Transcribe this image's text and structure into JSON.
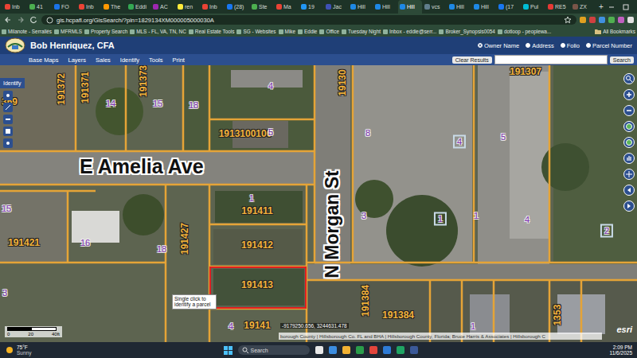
{
  "browser": {
    "tabs": [
      {
        "label": "Inb",
        "selected": false
      },
      {
        "label": "41",
        "selected": false
      },
      {
        "label": "FO",
        "selected": false
      },
      {
        "label": "Inb",
        "selected": false
      },
      {
        "label": "The",
        "selected": false
      },
      {
        "label": "Eddi",
        "selected": false
      },
      {
        "label": "AC",
        "selected": false
      },
      {
        "label": "ren",
        "selected": false
      },
      {
        "label": "Inb",
        "selected": false
      },
      {
        "label": "(28)",
        "selected": false
      },
      {
        "label": "Ste",
        "selected": false
      },
      {
        "label": "Ma",
        "selected": false
      },
      {
        "label": "19",
        "selected": false
      },
      {
        "label": "Jac",
        "selected": false
      },
      {
        "label": "Hill",
        "selected": false
      },
      {
        "label": "Hill",
        "selected": false
      },
      {
        "label": "Hill",
        "selected": true
      },
      {
        "label": "vcs",
        "selected": false
      },
      {
        "label": "Hill",
        "selected": false
      },
      {
        "label": "Hill",
        "selected": false
      },
      {
        "label": "(17",
        "selected": false
      },
      {
        "label": "Pul",
        "selected": false
      },
      {
        "label": "RE5",
        "selected": false
      },
      {
        "label": "ZX",
        "selected": false
      }
    ],
    "new_tab": "+",
    "url": "gis.hcpafl.org/GisSearch/?pin=1829134XM000005000030A",
    "bookmarks": [
      "Milanote - Serrallés",
      "MFRMLS",
      "Property Search",
      "MLS - FL, VA, TN, NC",
      "Real Estate Tools",
      "SG - Websites",
      "Mike",
      "Eddie",
      "Office",
      "Tuesday Night",
      "Inbox - eddie@serr...",
      "Broker_Synopsis0054",
      "dotloop - peoplewa..."
    ],
    "all_bookmarks": "All Bookmarks"
  },
  "app": {
    "owner": "Bob Henriquez,  CFA",
    "search_options": [
      {
        "label": "Owner Name",
        "selected": true
      },
      {
        "label": "Address",
        "selected": false
      },
      {
        "label": "Folio",
        "selected": false
      },
      {
        "label": "Parcel Number",
        "selected": false
      }
    ],
    "menu": [
      "Base Maps",
      "Layers",
      "Sales",
      "Identify",
      "Tools",
      "Print"
    ],
    "clear_button": "Clear Results",
    "search_value": "",
    "search_button": "Search"
  },
  "map": {
    "tool_button": "Identify",
    "streets": [
      "E Amelia Ave",
      "N Morgan St"
    ],
    "parcels": [
      {
        "label": "191371",
        "kind": "parcel",
        "boxed": false,
        "selected": false
      },
      {
        "label": "191373",
        "kind": "parcel",
        "boxed": false,
        "selected": false
      },
      {
        "label": "191372",
        "kind": "parcel",
        "boxed": false,
        "selected": false
      },
      {
        "label": "369",
        "kind": "parcel",
        "boxed": false,
        "selected": false
      },
      {
        "label": "14",
        "kind": "lot",
        "boxed": false,
        "selected": false
      },
      {
        "label": "15",
        "kind": "lot",
        "boxed": false,
        "selected": false
      },
      {
        "label": "18",
        "kind": "lot",
        "boxed": false,
        "selected": false
      },
      {
        "label": "4",
        "kind": "lot",
        "boxed": false,
        "selected": false
      },
      {
        "label": "1913100100",
        "kind": "parcel",
        "boxed": false,
        "selected": false
      },
      {
        "label": "5",
        "kind": "lot",
        "boxed": false,
        "selected": false
      },
      {
        "label": "19130",
        "kind": "parcel",
        "boxed": false,
        "selected": false
      },
      {
        "label": "191307",
        "kind": "parcel",
        "boxed": false,
        "selected": false
      },
      {
        "label": "8",
        "kind": "lot",
        "boxed": false,
        "selected": false
      },
      {
        "label": "4",
        "kind": "lot",
        "boxed": true,
        "selected": false
      },
      {
        "label": "5",
        "kind": "lot",
        "boxed": false,
        "selected": false
      },
      {
        "label": "15",
        "kind": "lot",
        "boxed": false,
        "selected": false
      },
      {
        "label": "191421",
        "kind": "parcel",
        "boxed": false,
        "selected": false
      },
      {
        "label": "16",
        "kind": "lot",
        "boxed": false,
        "selected": false
      },
      {
        "label": "18",
        "kind": "lot",
        "boxed": false,
        "selected": false
      },
      {
        "label": "191427",
        "kind": "parcel",
        "boxed": false,
        "selected": false
      },
      {
        "label": "1",
        "kind": "lot",
        "boxed": false,
        "selected": false
      },
      {
        "label": "191411",
        "kind": "parcel",
        "boxed": false,
        "selected": false
      },
      {
        "label": "191412",
        "kind": "parcel",
        "boxed": false,
        "selected": false
      },
      {
        "label": "191413",
        "kind": "parcel",
        "boxed": false,
        "selected": true
      },
      {
        "label": "3",
        "kind": "lot",
        "boxed": false,
        "selected": false
      },
      {
        "label": "1",
        "kind": "lot",
        "boxed": true,
        "selected": false
      },
      {
        "label": "1",
        "kind": "lot",
        "boxed": false,
        "selected": false
      },
      {
        "label": "4",
        "kind": "lot",
        "boxed": false,
        "selected": false
      },
      {
        "label": "2",
        "kind": "lot",
        "boxed": true,
        "selected": false
      },
      {
        "label": "4",
        "kind": "lot",
        "boxed": false,
        "selected": false
      },
      {
        "label": "19141",
        "kind": "parcel",
        "boxed": false,
        "selected": false
      },
      {
        "label": "191384",
        "kind": "parcel",
        "boxed": false,
        "selected": false
      },
      {
        "label": "191384",
        "kind": "parcel",
        "boxed": false,
        "selected": false
      },
      {
        "label": "1",
        "kind": "lot",
        "boxed": false,
        "selected": false
      },
      {
        "label": "1353",
        "kind": "parcel",
        "boxed": false,
        "selected": false
      },
      {
        "label": "3",
        "kind": "lot",
        "boxed": false,
        "selected": false
      }
    ],
    "tooltip": "Single click to identify a parcel",
    "coordinates": "-9179250.656, 3244631.478",
    "attribution": "borough County | Hillsborough Co. FL and BHA | Hillsborough County, Florida; Bruce Harris & Associates | Hillsborough C",
    "scale": [
      "0",
      "20",
      "40ft"
    ],
    "esri": "esri"
  },
  "taskbar": {
    "temperature": "75°F",
    "weather": "Sunny",
    "search_placeholder": "Search",
    "time": "2:09 PM",
    "date": "11/6/2025"
  }
}
